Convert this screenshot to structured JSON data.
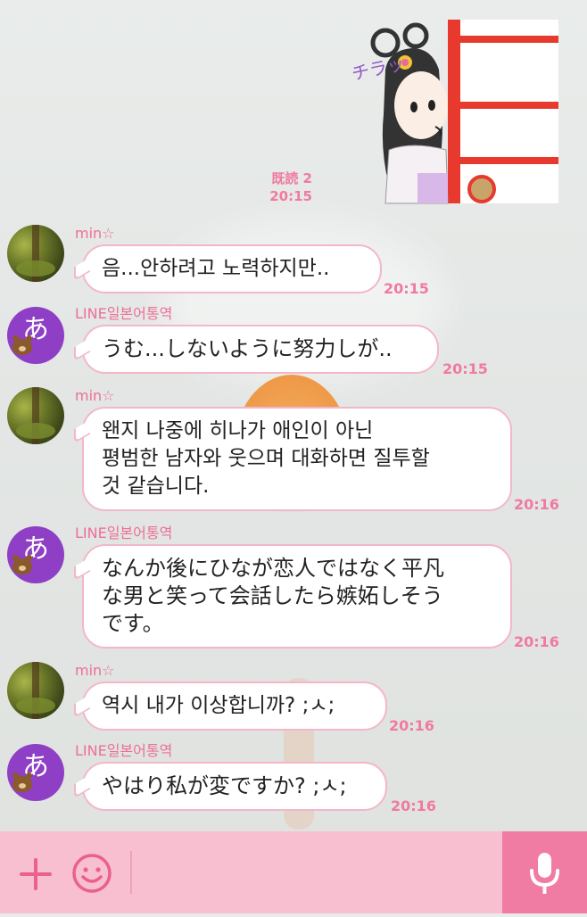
{
  "sticker": {
    "text": "チラッ"
  },
  "read_receipt": {
    "label": "既読 2",
    "time": "20:15"
  },
  "messages": [
    {
      "sender": "min☆",
      "text_lines": [
        "음...안하려고 노력하지만.."
      ],
      "time": "20:15",
      "avatar": "forest-photo"
    },
    {
      "sender": "LINE일본어통역",
      "text_lines": [
        "うむ...しないように努力しが.."
      ],
      "time": "20:15",
      "avatar": "a-hiragana-bear",
      "avatar_glyph": "あ"
    },
    {
      "sender": "min☆",
      "text_lines": [
        "왠지 나중에 히나가 애인이 아닌",
        "평범한 남자와 웃으며 대화하면 질투할",
        "것 같습니다."
      ],
      "time": "20:16",
      "avatar": "forest-photo"
    },
    {
      "sender": "LINE일본어통역",
      "text_lines": [
        "なんか後にひなが恋人ではなく平凡",
        "な男と笑って会話したら嫉妬しそう",
        "です。"
      ],
      "time": "20:16",
      "avatar": "a-hiragana-bear",
      "avatar_glyph": "あ"
    },
    {
      "sender": "min☆",
      "text_lines": [
        "역시 내가 이상합니까? ;ㅅ;"
      ],
      "time": "20:16",
      "avatar": "forest-photo"
    },
    {
      "sender": "LINE일본어통역",
      "text_lines": [
        "やはり私が変ですか? ;ㅅ;"
      ],
      "time": "20:16",
      "avatar": "a-hiragana-bear",
      "avatar_glyph": "あ"
    }
  ],
  "input_bar": {
    "left_icons": [
      "plus-icon",
      "emoji-icon"
    ],
    "right_icon": "microphone-icon"
  },
  "colors": {
    "accent_pink": "#f07aa0",
    "bottom_bar": "#f8bfd0",
    "mic_button": "#f07ba3",
    "avatar_purple": "#8e3fc5"
  }
}
